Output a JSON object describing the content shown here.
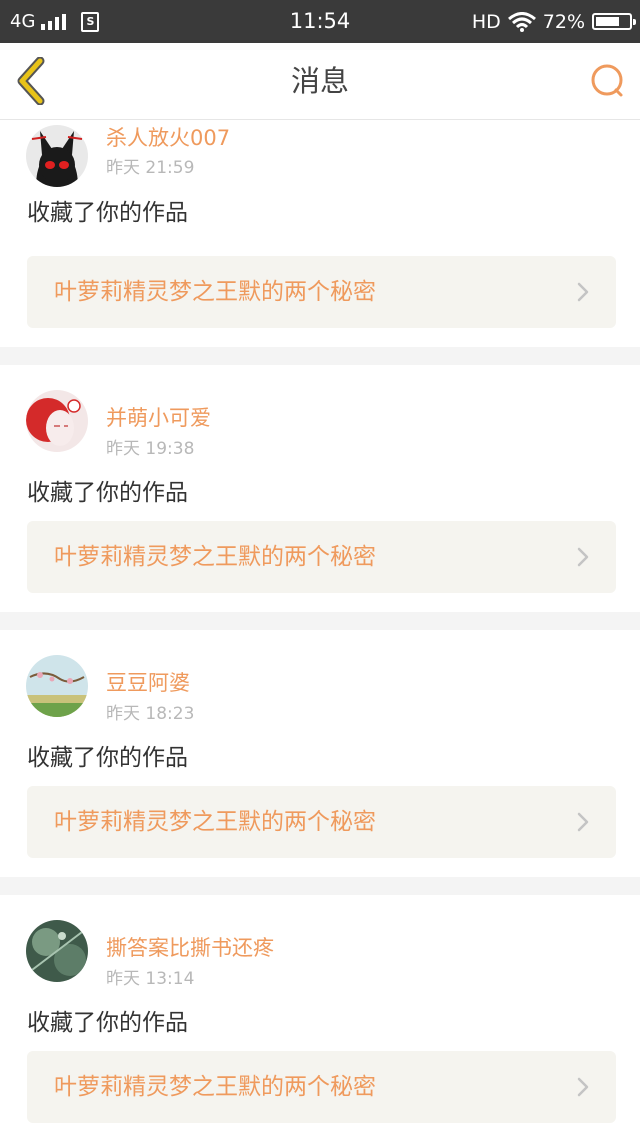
{
  "status_bar": {
    "network": "4G",
    "sim_label": "S",
    "time": "11:54",
    "hd": "HD",
    "battery_percent": "72%",
    "battery_level": 0.72
  },
  "nav": {
    "title": "消息",
    "back_icon": "chevron-left-icon",
    "search_icon": "search-icon"
  },
  "colors": {
    "accent_orange": "#ef9a5d",
    "back_yellow": "#e8c319",
    "card_bg": "#f5f4ef"
  },
  "messages": [
    {
      "user": "杀人放火007",
      "time": "昨天 21:59",
      "action": "收藏了你的作品",
      "work_title": "叶萝莉精灵梦之王默的两个秘密"
    },
    {
      "user": "并萌小可爱",
      "time": "昨天 19:38",
      "action": "收藏了你的作品",
      "work_title": "叶萝莉精灵梦之王默的两个秘密"
    },
    {
      "user": "豆豆阿婆",
      "time": "昨天 18:23",
      "action": "收藏了你的作品",
      "work_title": "叶萝莉精灵梦之王默的两个秘密"
    },
    {
      "user": "撕答案比撕书还疼",
      "time": "昨天 13:14",
      "action": "收藏了你的作品",
      "work_title": "叶萝莉精灵梦之王默的两个秘密"
    }
  ]
}
